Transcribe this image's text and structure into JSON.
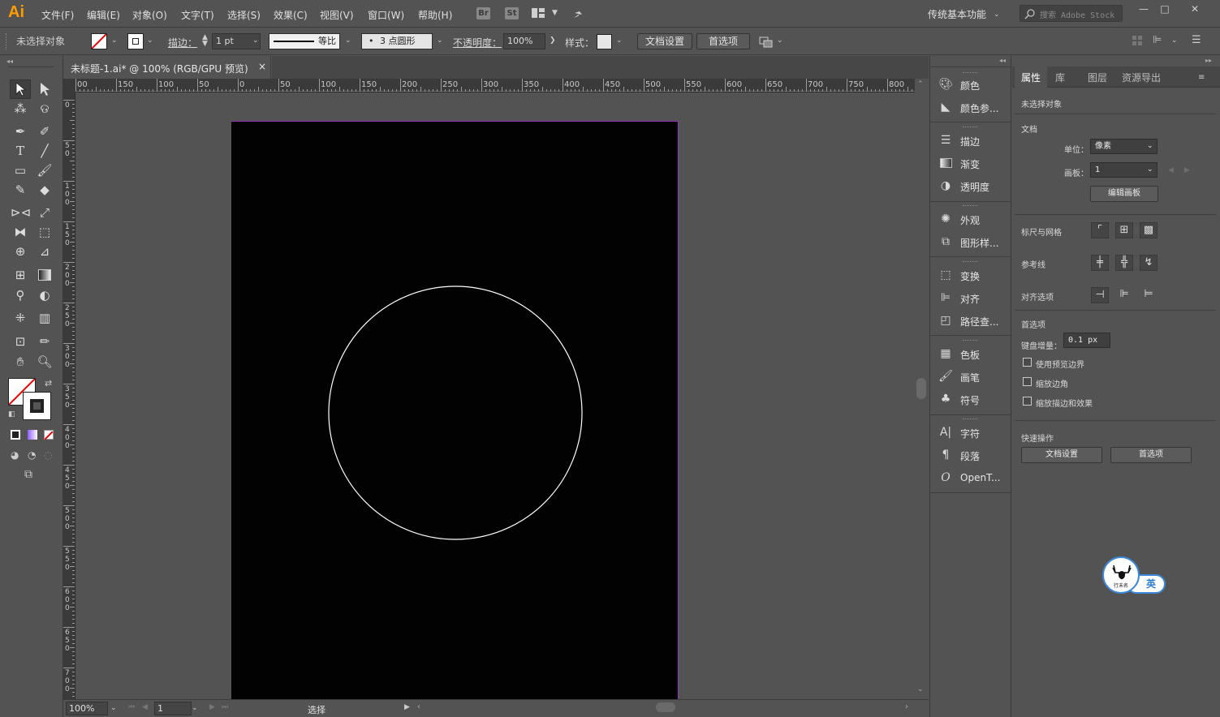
{
  "app": {
    "logo": "Ai"
  },
  "menu": [
    "文件(F)",
    "编辑(E)",
    "对象(O)",
    "文字(T)",
    "选择(S)",
    "效果(C)",
    "视图(V)",
    "窗口(W)",
    "帮助(H)"
  ],
  "menu_icons": {
    "bridge": "Br",
    "stock": "St"
  },
  "workspace": "传统基本功能",
  "search": {
    "placeholder": "搜索 Adobe Stock"
  },
  "window_controls": {
    "minimize": "—",
    "maximize": "□",
    "close": "✕"
  },
  "control_bar": {
    "selection_status": "未选择对象",
    "stroke_label": "描边：",
    "stroke_weight": "1 pt",
    "profile_label": "等比",
    "brush_value": "3 点圆形",
    "opacity_label": "不透明度：",
    "opacity_value": "100%",
    "style_label": "样式：",
    "doc_setup": "文档设置",
    "preferences": "首选项"
  },
  "document_tab": {
    "title": "未标题-1.ai* @ 100% (RGB/GPU 预览)",
    "close": "×"
  },
  "ruler_top": [
    "00",
    "150",
    "100",
    "50",
    "0",
    "50",
    "100",
    "150",
    "200",
    "250",
    "300",
    "350",
    "400",
    "450",
    "500",
    "550",
    "600",
    "650",
    "700",
    "750",
    "800"
  ],
  "ruler_left": [
    "0",
    "50",
    "100",
    "150",
    "200",
    "250",
    "300",
    "350",
    "400",
    "450",
    "500",
    "550",
    "600",
    "650",
    "700"
  ],
  "status_bar": {
    "zoom": "100%",
    "artboard_num": "1",
    "tool_status": "选择"
  },
  "mid_panel": [
    {
      "icon": "color-icon",
      "label": "颜色"
    },
    {
      "icon": "color-guide-icon",
      "label": "颜色参..."
    },
    {
      "icon": "stroke-icon",
      "label": "描边"
    },
    {
      "icon": "gradient-icon",
      "label": "渐变"
    },
    {
      "icon": "transparency-icon",
      "label": "透明度"
    },
    {
      "icon": "appearance-icon",
      "label": "外观"
    },
    {
      "icon": "graphic-styles-icon",
      "label": "图形样..."
    },
    {
      "icon": "transform-icon",
      "label": "变换"
    },
    {
      "icon": "align-icon",
      "label": "对齐"
    },
    {
      "icon": "pathfinder-icon",
      "label": "路径查..."
    },
    {
      "icon": "swatches-icon",
      "label": "色板"
    },
    {
      "icon": "brushes-icon",
      "label": "画笔"
    },
    {
      "icon": "symbols-icon",
      "label": "符号"
    },
    {
      "icon": "character-icon",
      "label": "字符"
    },
    {
      "icon": "paragraph-icon",
      "label": "段落"
    },
    {
      "icon": "opentype-icon",
      "label": "OpenT..."
    }
  ],
  "right_panel": {
    "tabs": [
      "属性",
      "库",
      "图层",
      "资源导出"
    ],
    "no_selection": "未选择对象",
    "document_section": "文档",
    "units_label": "单位：",
    "units_value": "像素",
    "artboard_label": "画板：",
    "artboard_value": "1",
    "edit_artboards": "编辑画板",
    "rulers_grids": "标尺与网格",
    "guides": "参考线",
    "align_options": "对齐选项",
    "preferences_section": "首选项",
    "keyboard_increment_label": "键盘增量：",
    "keyboard_increment_value": "0.1 px",
    "checkboxes": [
      "使用预览边界",
      "缩放边角",
      "缩放描边和效果"
    ],
    "quick_actions": "快速操作",
    "doc_setup_btn": "文档设置",
    "prefs_btn": "首选项"
  },
  "ime": {
    "mode": "英",
    "logo_text": "行未名"
  },
  "colors": {
    "accent": "#ff9a00",
    "artboard": "#020202",
    "artboard_border": "#9a2fc0",
    "ui_bg": "#535353"
  }
}
